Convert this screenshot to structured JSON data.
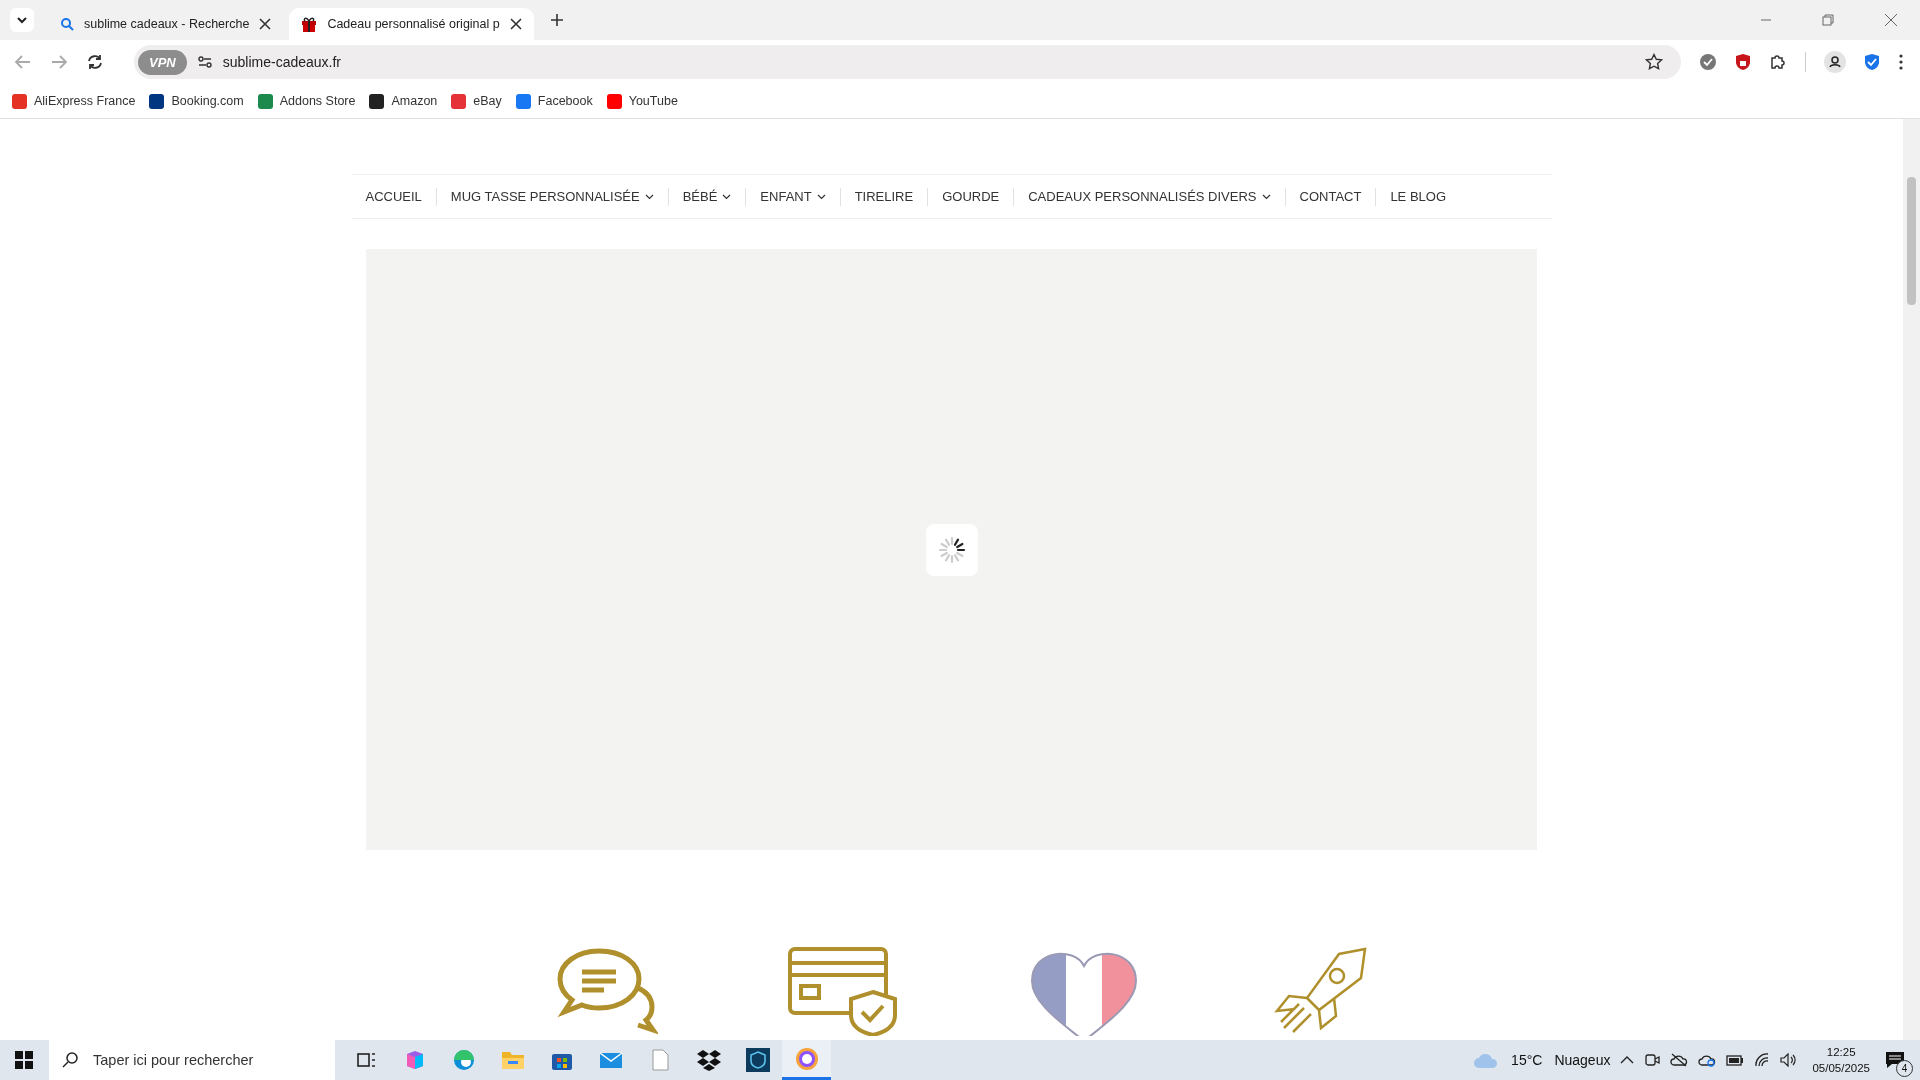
{
  "browser": {
    "tabs": [
      {
        "title": "sublime cadeaux - Recherche",
        "selected": false,
        "kind": "search"
      },
      {
        "title": "Cadeau personnalisé original p",
        "selected": true,
        "kind": "gift"
      }
    ],
    "url": "sublime-cadeaux.fr",
    "vpn_label": "VPN",
    "bookmarks": [
      {
        "label": "AliExpress France",
        "color": "#e43225"
      },
      {
        "label": "Booking.com",
        "color": "#003580"
      },
      {
        "label": "Addons Store",
        "color": "#1b8a4c"
      },
      {
        "label": "Amazon",
        "color": "#222222"
      },
      {
        "label": "eBay",
        "color": "#e53238"
      },
      {
        "label": "Facebook",
        "color": "#1877f2"
      },
      {
        "label": "YouTube",
        "color": "#ff0000"
      }
    ]
  },
  "site_nav": [
    {
      "label": "ACCUEIL",
      "has_dropdown": false
    },
    {
      "label": "MUG TASSE PERSONNALISÉE",
      "has_dropdown": true
    },
    {
      "label": "BÉBÉ",
      "has_dropdown": true
    },
    {
      "label": "ENFANT",
      "has_dropdown": true
    },
    {
      "label": "TIRELIRE",
      "has_dropdown": false
    },
    {
      "label": "GOURDE",
      "has_dropdown": false
    },
    {
      "label": "CADEAUX PERSONNALISÉS DIVERS",
      "has_dropdown": true
    },
    {
      "label": "CONTACT",
      "has_dropdown": false
    },
    {
      "label": "LE BLOG",
      "has_dropdown": false
    }
  ],
  "taskbar": {
    "search_placeholder": "Taper ici pour rechercher",
    "apps": [
      {
        "kind": "taskview",
        "selected": false
      },
      {
        "kind": "copilot",
        "selected": false
      },
      {
        "kind": "edge",
        "selected": false
      },
      {
        "kind": "folder",
        "selected": false
      },
      {
        "kind": "store",
        "selected": false
      },
      {
        "kind": "mail",
        "selected": false
      },
      {
        "kind": "file",
        "selected": false
      },
      {
        "kind": "dropbox",
        "selected": false
      },
      {
        "kind": "shield",
        "selected": false
      },
      {
        "kind": "browser",
        "selected": true
      }
    ],
    "temperature": "15°C",
    "weather": "Nuageux",
    "time": "12:25",
    "date": "05/05/2025",
    "notifications": "4"
  }
}
